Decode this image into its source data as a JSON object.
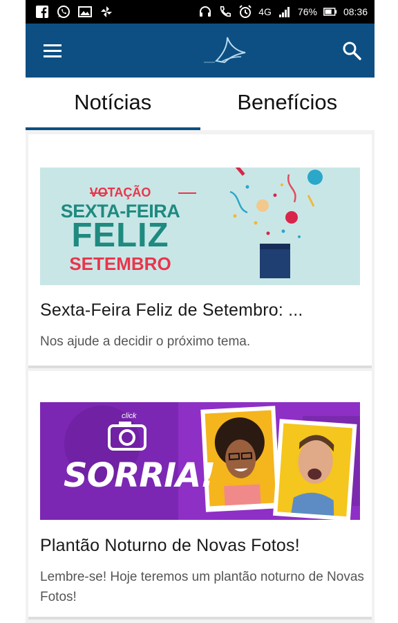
{
  "status_bar": {
    "battery": "76%",
    "time": "08:36",
    "network": "4G",
    "icons_left": [
      "facebook-icon",
      "whatsapp-icon",
      "gallery-icon",
      "pinwheel-icon"
    ],
    "icons_right": [
      "headset-icon",
      "call-icon",
      "alarm-icon",
      "signal-icon",
      "battery-icon"
    ]
  },
  "appbar": {
    "background": "#0d4f82",
    "menu_icon": "menu-icon",
    "logo_icon": "bird-logo-icon",
    "search_icon": "search-icon"
  },
  "tabs": [
    {
      "label": "Notícias",
      "active": true
    },
    {
      "label": "Benefícios",
      "active": false
    }
  ],
  "news": [
    {
      "title": "Sexta-Feira Feliz de Setembro: ...",
      "subtitle": "Nos ajude a decidir o próximo tema.",
      "banner": {
        "tag": "VOTAÇÃO",
        "line1": "SEXTA-FEIRA",
        "line2": "FELIZ",
        "line3": "SETEMBRO"
      }
    },
    {
      "title": "Plantão Noturno de Novas Fotos!",
      "subtitle": "Lembre-se! Hoje teremos um plantão noturno de Novas Fotos!",
      "banner": {
        "click_text": "click",
        "headline": "SORRIA!"
      }
    }
  ]
}
